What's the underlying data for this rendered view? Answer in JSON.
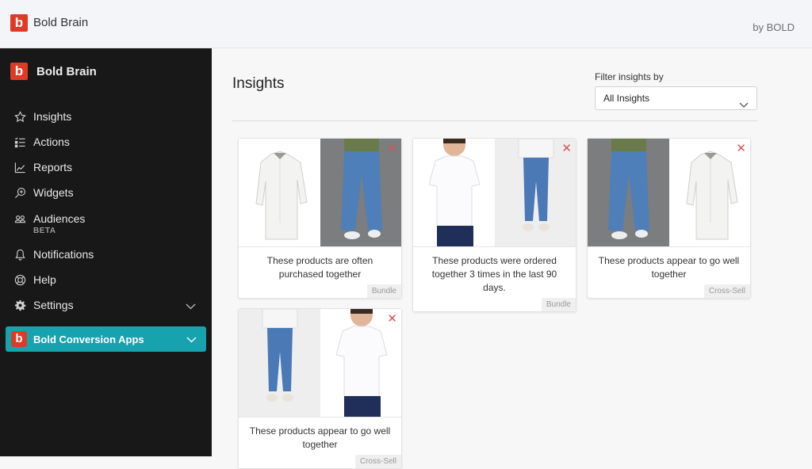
{
  "topbar": {
    "app_title": "Bold Brain",
    "by_label": "by BOLD",
    "logo_letter": "b"
  },
  "sidebar": {
    "brand": "Bold Brain",
    "items": [
      {
        "label": "Insights",
        "icon": "star-icon"
      },
      {
        "label": "Actions",
        "icon": "checklist-icon"
      },
      {
        "label": "Reports",
        "icon": "line-chart-icon"
      },
      {
        "label": "Widgets",
        "icon": "magnify-plus-icon"
      },
      {
        "label": "Audiences",
        "sublabel": "BETA",
        "icon": "users-icon"
      },
      {
        "label": "Notifications",
        "icon": "bell-icon"
      },
      {
        "label": "Help",
        "icon": "lifebuoy-icon"
      },
      {
        "label": "Settings",
        "icon": "gear-icon"
      }
    ],
    "apps_button": "Bold Conversion Apps"
  },
  "main": {
    "title": "Insights",
    "filter": {
      "label": "Filter insights by",
      "selected": "All Insights"
    },
    "cards": [
      {
        "left": "white shirt",
        "right": "men's ripped jeans",
        "description": "These products are often purchased together",
        "tag": "Bundle"
      },
      {
        "left": "women's white t-shirt",
        "right": "women's ripped skinny jeans",
        "description": "These products were ordered together 3 times in the last 90 days.",
        "tag": "Bundle"
      },
      {
        "left": "men's ripped jeans",
        "right": "white shirt",
        "description": "These products appear to go well together",
        "tag": "Cross-Sell"
      },
      {
        "left": "women's ripped skinny jeans",
        "right": "women's white t-shirt",
        "description": "These products appear to go well together",
        "tag": "Cross-Sell"
      }
    ]
  },
  "colors": {
    "brand_red": "#dd3b26",
    "accent_teal": "#16a3ad",
    "sidebar_bg": "#181818",
    "close_red": "#d9534f"
  }
}
